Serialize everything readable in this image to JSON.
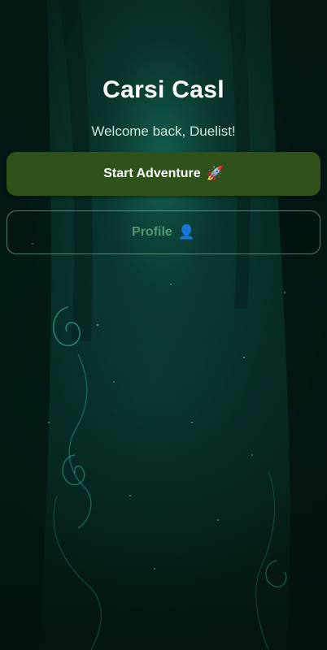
{
  "app": {
    "title": "Carsi Casl",
    "subtitle": "Welcome back, Duelist!"
  },
  "actions": {
    "start": {
      "label": "Start Adventure",
      "icon": "🚀",
      "icon_name": "rocket-icon"
    },
    "profile": {
      "label": "Profile",
      "icon": "👤",
      "icon_name": "person-icon"
    }
  },
  "colors": {
    "background": "#072823",
    "primary_button": "#2f521b",
    "secondary_text": "#4f9a6c",
    "subtitle_text": "#cfe8d6"
  }
}
